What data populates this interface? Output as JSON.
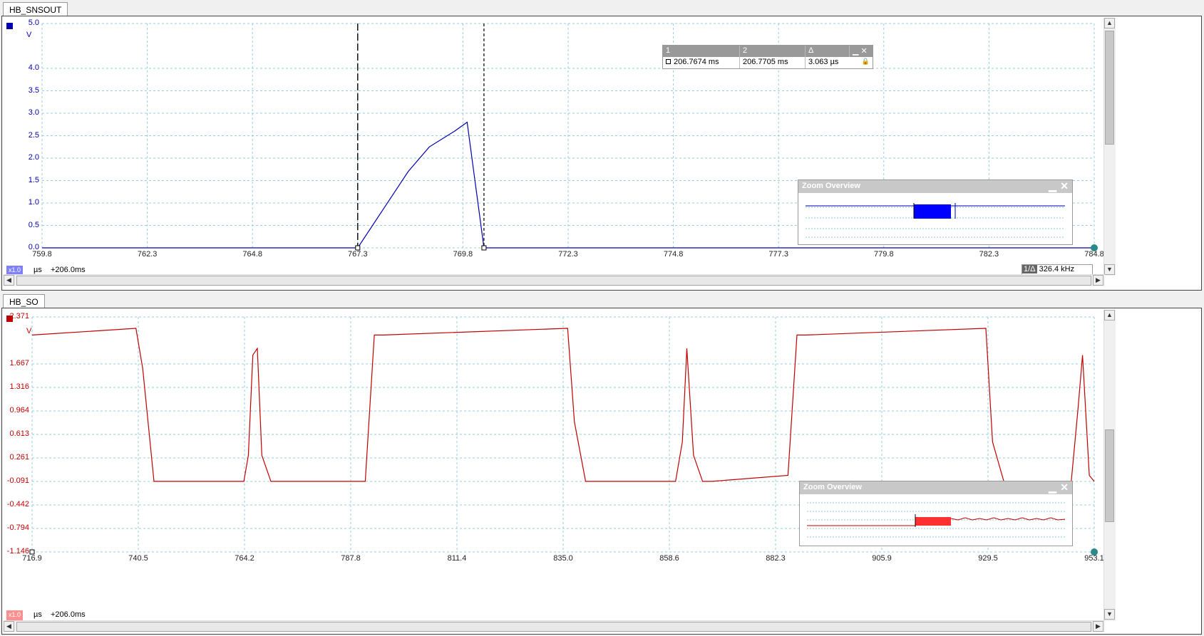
{
  "panels": [
    {
      "id": "top",
      "tab_label": "HB_SNSOUT",
      "color": "#0000b0",
      "unit": "V",
      "y_ticks": [
        "5.0",
        "4.0",
        "3.5",
        "3.0",
        "2.5",
        "2.0",
        "1.5",
        "1.0",
        "0.5",
        "0.0"
      ],
      "x_ticks": [
        "759.8",
        "762.3",
        "764.8",
        "767.3",
        "769.8",
        "772.3",
        "774.8",
        "777.3",
        "779.8",
        "782.3",
        "784.8"
      ],
      "x_unit": "µs",
      "offset": "+206.0ms",
      "scale_badge": "x1.0",
      "freq_label": "1/Δ",
      "freq_value": "326.4 kHz"
    },
    {
      "id": "bottom",
      "tab_label": "HB_SO",
      "color": "#c00000",
      "unit": "V",
      "y_ticks": [
        "2.371",
        "1.667",
        "1.316",
        "0.964",
        "0.613",
        "0.261",
        "-0.091",
        "-0.442",
        "-0.794",
        "-1.146"
      ],
      "x_ticks": [
        "716.9",
        "740.5",
        "764.2",
        "787.8",
        "811.4",
        "835.0",
        "858.6",
        "882.3",
        "905.9",
        "929.5",
        "953.1"
      ],
      "x_unit": "µs",
      "offset": "+206.0ms",
      "scale_badge": "x1.0"
    }
  ],
  "cursor_table": {
    "headers": [
      "1",
      "2",
      "Δ"
    ],
    "values": [
      "206.7674 ms",
      "206.7705 ms",
      "3.063 µs"
    ]
  },
  "zoom_overview": {
    "title": "Zoom Overview",
    "minimize": "▁",
    "close": "✕"
  },
  "chart_data": [
    {
      "type": "line",
      "series": [
        {
          "name": "HB_SNSOUT",
          "color": "#0000b0",
          "x": [
            759.8,
            767.3,
            767.9,
            768.5,
            769.0,
            769.6,
            769.9,
            770.3,
            784.8
          ],
          "y": [
            0.0,
            0.0,
            0.85,
            1.7,
            2.25,
            2.6,
            2.8,
            0.0,
            0.0
          ]
        }
      ],
      "xlim": [
        759.8,
        784.8
      ],
      "ylim": [
        0.0,
        5.0
      ],
      "xlabel": "µs",
      "ylabel": "V",
      "grid": true
    },
    {
      "type": "line",
      "series": [
        {
          "name": "HB_SO",
          "color": "#c00000",
          "x": [
            716.9,
            740.0,
            741.5,
            744.0,
            764.0,
            765.0,
            766.0,
            767.0,
            768.0,
            770.0,
            791.0,
            793.0,
            795.0,
            836.0,
            837.5,
            840.0,
            860.0,
            861.5,
            862.5,
            864.0,
            866.0,
            868.0,
            885.0,
            887.0,
            889.0,
            929.0,
            930.5,
            933.0,
            948.0,
            949.5,
            950.5,
            952.0,
            953.1
          ],
          "y": [
            2.1,
            2.2,
            1.6,
            -0.09,
            -0.09,
            0.3,
            1.8,
            1.9,
            0.3,
            -0.09,
            -0.09,
            2.1,
            2.1,
            2.2,
            0.8,
            -0.09,
            -0.09,
            0.5,
            1.9,
            0.3,
            -0.09,
            -0.09,
            0.0,
            2.1,
            2.1,
            2.2,
            0.5,
            -0.09,
            -0.09,
            1.0,
            1.8,
            0.0,
            -0.09
          ]
        }
      ],
      "xlim": [
        716.9,
        953.1
      ],
      "ylim": [
        -1.146,
        2.371
      ],
      "xlabel": "µs",
      "ylabel": "V",
      "grid": true
    }
  ]
}
